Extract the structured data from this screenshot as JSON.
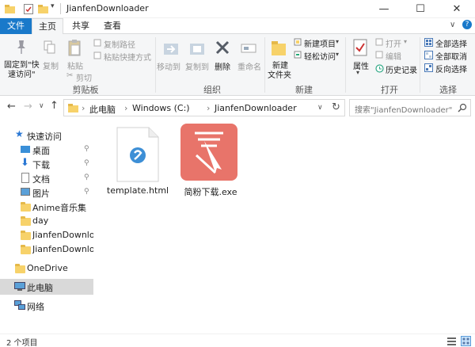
{
  "window": {
    "title": "JianfenDownloader",
    "min_glyph": "—",
    "max_glyph": "☐",
    "close_glyph": "✕"
  },
  "ribbon_tabs": [
    "文件",
    "主页",
    "共享",
    "查看"
  ],
  "ribbon": {
    "clipboard": {
      "pin_label_1": "固定到\"快",
      "pin_label_2": "速访问\"",
      "copy": "复制",
      "paste": "粘贴",
      "copy_path": "复制路径",
      "paste_shortcut": "粘贴快捷方式",
      "cut": "剪切",
      "group": "剪贴板"
    },
    "organize": {
      "move_to": "移动到",
      "copy_to": "复制到",
      "delete": "删除",
      "rename": "重命名",
      "group": "组织"
    },
    "new": {
      "new_folder_1": "新建",
      "new_folder_2": "文件夹",
      "new_item": "新建项目",
      "easy_access": "轻松访问",
      "group": "新建"
    },
    "open": {
      "properties": "属性",
      "open": "打开",
      "edit": "编辑",
      "history": "历史记录",
      "group": "打开"
    },
    "select": {
      "select_all": "全部选择",
      "select_none": "全部取消",
      "invert": "反向选择",
      "group": "选择"
    }
  },
  "nav": {
    "back": "←",
    "forward": "→",
    "recent": "∨",
    "up": "↑",
    "breadcrumb": [
      "此电脑",
      "Windows (C:)",
      "JianfenDownloader"
    ],
    "sep": "›",
    "search_placeholder": "搜索\"JianfenDownloader\"",
    "refresh": "↻",
    "dropdown": "∨"
  },
  "sidebar": {
    "quick_access": "快速访问",
    "items": [
      {
        "label": "桌面",
        "pinned": true
      },
      {
        "label": "下载",
        "pinned": true
      },
      {
        "label": "文档",
        "pinned": true
      },
      {
        "label": "图片",
        "pinned": true
      },
      {
        "label": "Anime音乐集",
        "pinned": false
      },
      {
        "label": "day",
        "pinned": false
      },
      {
        "label": "JianfenDownloade",
        "pinned": false
      },
      {
        "label": "JianfenDownloade",
        "pinned": false
      }
    ],
    "onedrive": "OneDrive",
    "this_pc": "此电脑",
    "network": "网络",
    "pin_glyph": "📌"
  },
  "files": [
    {
      "name": "template.html",
      "icon": "html-file-icon"
    },
    {
      "name": "简粉下载.exe",
      "icon": "app-icon",
      "color": "#e8746a"
    }
  ],
  "status": {
    "count": "2 个项目"
  },
  "colors": {
    "accent": "#1979ca",
    "selection": "#cce8ff",
    "app_icon": "#e8746a"
  }
}
